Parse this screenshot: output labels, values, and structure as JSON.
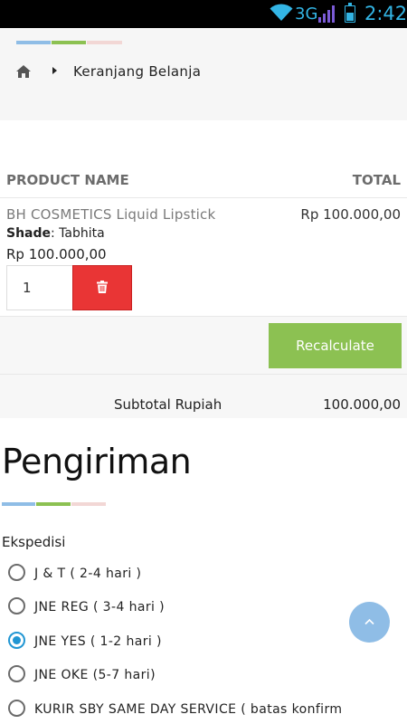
{
  "status_bar": {
    "network": "3G",
    "time": "2:42",
    "wifi_icon": "wifi-icon",
    "signal_icon": "signal-icon",
    "battery_icon": "battery-icon"
  },
  "breadcrumb": {
    "home_icon": "home-icon",
    "current": "Keranjang Belanja"
  },
  "cart": {
    "columns": [
      "PRODUCT NAME",
      "TOTAL"
    ],
    "items": [
      {
        "name": "BH COSMETICS Liquid Lipstick",
        "shade_label": "Shade",
        "shade_value": ": Tabhita",
        "price": "Rp 100.000,00",
        "total": "Rp 100.000,00",
        "quantity": "1"
      }
    ],
    "recalculate_label": "Recalculate",
    "subtotal_label": "Subtotal Rupiah",
    "subtotal_value": "100.000,00"
  },
  "shipping": {
    "title": "Pengiriman",
    "label": "Ekspedisi",
    "options": [
      {
        "label": "J & T ( 2-4 hari )",
        "selected": false
      },
      {
        "label": "JNE REG ( 3-4 hari )",
        "selected": false
      },
      {
        "label": "JNE YES ( 1-2 hari )",
        "selected": true
      },
      {
        "label": "JNE OKE (5-7 hari)",
        "selected": false
      },
      {
        "label": "KURIR SBY SAME DAY SERVICE ( batas konfirm",
        "selected": false
      }
    ]
  },
  "colors": {
    "accent_blue": "#8fbde6",
    "accent_green": "#8cc152",
    "accent_pink": "#f2d7d5",
    "delete_red": "#e93535",
    "radio_blue": "#2196d3"
  },
  "scroll_top_icon": "chevron-up-icon"
}
